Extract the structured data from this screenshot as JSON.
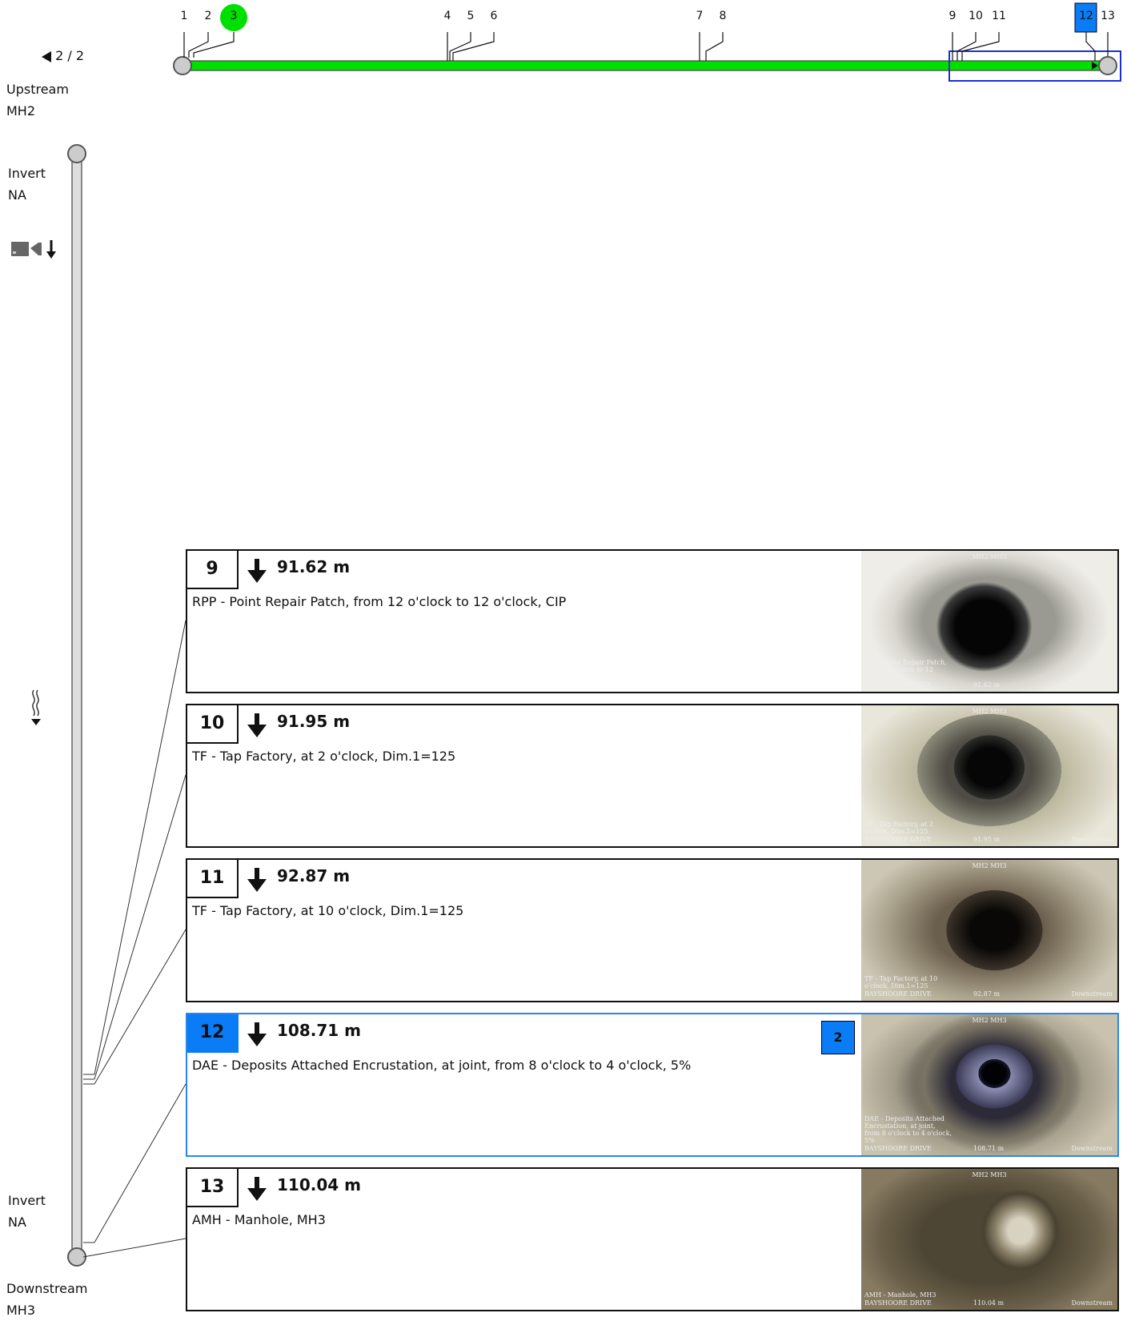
{
  "nav": {
    "page_indicator": "2 / 2"
  },
  "upstream": {
    "label": "Upstream",
    "node": "MH2"
  },
  "downstream": {
    "label": "Downstream",
    "node": "MH3"
  },
  "invert_top": {
    "label": "Invert",
    "value": "NA"
  },
  "invert_bottom": {
    "label": "Invert",
    "value": "NA"
  },
  "icons": {
    "camera": "camera-icon",
    "direction": "arrow-down-icon",
    "flow": "flow-icon"
  },
  "colors": {
    "pipe": "#00e000",
    "accent": "#0a7cf5",
    "selection_box": "#1b2fd0",
    "selected_border": "#2b86e8"
  },
  "timeline": {
    "ticks": [
      "1",
      "2",
      "3",
      "4",
      "5",
      "6",
      "7",
      "8",
      "9",
      "10",
      "11",
      "12",
      "13"
    ],
    "highlighted_green": "3",
    "highlighted_blue": "12"
  },
  "observations": [
    {
      "number": "9",
      "distance": "91.62 m",
      "description": "RPP - Point Repair Patch, from 12 o'clock to 12 o'clock, CIP",
      "thumb_head": "MH2 MH3",
      "thumb_left": "MH2",
      "thumb_right": "MH3",
      "thumb_caption": "RPP - Point Repair Patch, from 12 o'clock to 12 o'clock, CIP",
      "thumb_street": "BAYSHOORE DRIVE",
      "thumb_distance": "91.62 m",
      "thumb_direction": "Downstream",
      "selected": false,
      "badge": ""
    },
    {
      "number": "10",
      "distance": "91.95 m",
      "description": "TF - Tap Factory, at 2 o'clock, Dim.1=125",
      "thumb_head": "MH2 MH3",
      "thumb_left": "MH2",
      "thumb_right": "MH3",
      "thumb_caption": "TF - Tap Factory, at 2 o'clock, Dim.1=125",
      "thumb_street": "BAYSHOORE DRIVE",
      "thumb_distance": "91.95 m",
      "thumb_direction": "Downstream",
      "selected": false,
      "badge": ""
    },
    {
      "number": "11",
      "distance": "92.87 m",
      "description": "TF - Tap Factory, at 10 o'clock, Dim.1=125",
      "thumb_head": "MH2 MH3",
      "thumb_left": "MH2",
      "thumb_right": "MH3",
      "thumb_caption": "TF - Tap Factory, at 10 o'clock, Dim.1=125",
      "thumb_street": "BAYSHOORE DRIVE",
      "thumb_distance": "92.87 m",
      "thumb_direction": "Downstream",
      "selected": false,
      "badge": ""
    },
    {
      "number": "12",
      "distance": "108.71 m",
      "description": "DAE - Deposits Attached Encrustation, at joint, from 8 o'clock to 4 o'clock, 5%",
      "thumb_head": "MH2 MH3",
      "thumb_left": "MH2",
      "thumb_right": "MH3",
      "thumb_caption": "DAE - Deposits Attached Encrustation, at joint, from 8 o'clock to 4 o'clock, 5%",
      "thumb_street": "BAYSHOORE DRIVE",
      "thumb_distance": "108.71 m",
      "thumb_direction": "Downstream",
      "selected": true,
      "badge": "2"
    },
    {
      "number": "13",
      "distance": "110.04 m",
      "description": "AMH - Manhole, MH3",
      "thumb_head": "MH2 MH3",
      "thumb_left": "MH2",
      "thumb_right": "MH3",
      "thumb_caption": "AMH - Manhole, MH3",
      "thumb_street": "BAYSHOORE DRIVE",
      "thumb_distance": "110.04 m",
      "thumb_direction": "Downstream",
      "selected": false,
      "badge": ""
    }
  ]
}
